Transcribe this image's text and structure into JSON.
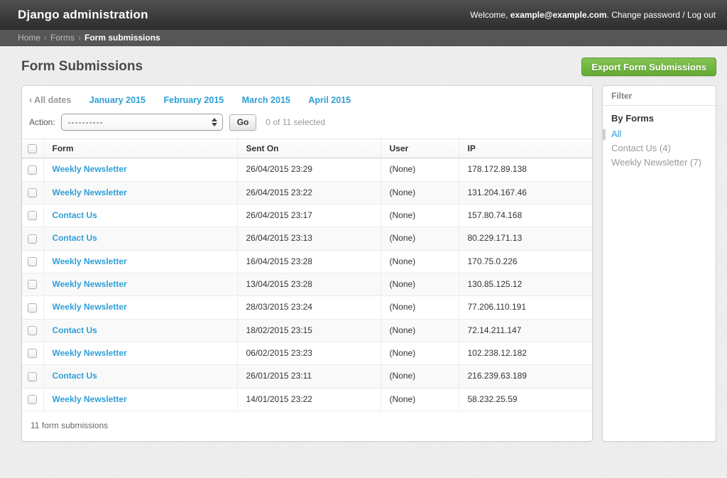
{
  "header": {
    "branding": "Django administration",
    "welcome_prefix": "Welcome, ",
    "username": "example@example.com",
    "after_username": ". ",
    "change_password_label": "Change password",
    "link_separator": " / ",
    "logout_label": "Log out"
  },
  "breadcrumb": {
    "items": [
      "Home",
      "Forms"
    ],
    "separator": "›",
    "current": "Form submissions"
  },
  "page": {
    "title": "Form Submissions",
    "export_button_label": "Export Form Submissions"
  },
  "date_hierarchy": {
    "back_label": "‹ All dates",
    "links": [
      "January 2015",
      "February 2015",
      "March 2015",
      "April 2015"
    ]
  },
  "actions": {
    "label": "Action:",
    "selected_option": "----------",
    "go_label": "Go",
    "counter": "0 of 11 selected"
  },
  "table": {
    "columns": [
      "Form",
      "Sent On",
      "User",
      "IP"
    ],
    "rows": [
      {
        "form": "Weekly Newsletter",
        "sent_on": "26/04/2015 23:29",
        "user": "(None)",
        "ip": "178.172.89.138"
      },
      {
        "form": "Weekly Newsletter",
        "sent_on": "26/04/2015 23:22",
        "user": "(None)",
        "ip": "131.204.167.46"
      },
      {
        "form": "Contact Us",
        "sent_on": "26/04/2015 23:17",
        "user": "(None)",
        "ip": "157.80.74.168"
      },
      {
        "form": "Contact Us",
        "sent_on": "26/04/2015 23:13",
        "user": "(None)",
        "ip": "80.229.171.13"
      },
      {
        "form": "Weekly Newsletter",
        "sent_on": "16/04/2015 23:28",
        "user": "(None)",
        "ip": "170.75.0.226"
      },
      {
        "form": "Weekly Newsletter",
        "sent_on": "13/04/2015 23:28",
        "user": "(None)",
        "ip": "130.85.125.12"
      },
      {
        "form": "Weekly Newsletter",
        "sent_on": "28/03/2015 23:24",
        "user": "(None)",
        "ip": "77.206.110.191"
      },
      {
        "form": "Contact Us",
        "sent_on": "18/02/2015 23:15",
        "user": "(None)",
        "ip": "72.14.211.147"
      },
      {
        "form": "Weekly Newsletter",
        "sent_on": "06/02/2015 23:23",
        "user": "(None)",
        "ip": "102.238.12.182"
      },
      {
        "form": "Contact Us",
        "sent_on": "26/01/2015 23:11",
        "user": "(None)",
        "ip": "216.239.63.189"
      },
      {
        "form": "Weekly Newsletter",
        "sent_on": "14/01/2015 23:22",
        "user": "(None)",
        "ip": "58.232.25.59"
      }
    ],
    "summary": "11 form submissions"
  },
  "filter": {
    "title": "Filter",
    "section_title": "By Forms",
    "options": [
      {
        "label": "All",
        "selected": true
      },
      {
        "label": "Contact Us (4)",
        "selected": false
      },
      {
        "label": "Weekly Newsletter (7)",
        "selected": false
      }
    ]
  },
  "colors": {
    "link_blue": "#2e9fd8",
    "button_green": "#63ac32",
    "header_dark": "#2c2c2c"
  }
}
